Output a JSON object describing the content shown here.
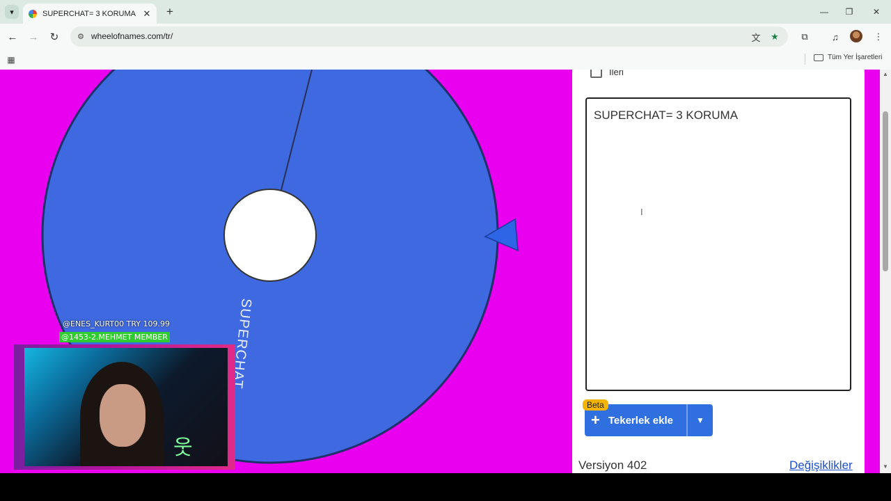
{
  "browser": {
    "tab_title": "SUPERCHAT= 3 KORUMA",
    "url": "wheelofnames.com/tr/",
    "bookmarks_label": "Tüm Yer İşaretleri"
  },
  "overlay": {
    "chat_line_1": "@ENES_KURT00  TRY 109.99",
    "chat_line_2": "@1453-2.MEHMET  MEMBER"
  },
  "wheel": {
    "segment_label": "SUPERCHAT",
    "color": "#3f69e0"
  },
  "sidebar": {
    "checkbox_label": "İleri",
    "entries_text": "SUPERCHAT= 3 KORUMA",
    "beta_badge": "Beta",
    "add_wheel_label": "Tekerlek ekle",
    "version": "Versiyon 402",
    "changes_link": "Değişiklikler"
  },
  "icons": {
    "tab_menu": "▾",
    "close": "✕",
    "new_tab": "+",
    "minimize": "—",
    "restore": "❐",
    "back": "←",
    "forward": "→",
    "reload": "↻",
    "site_info": "⚙",
    "translate": "文",
    "star": "★",
    "extensions": "⧉",
    "media": "♫",
    "menu": "⋮",
    "apps": "▦",
    "plus": "+",
    "dropdown": "▼",
    "ibeam": "I",
    "scroll_up": "▲",
    "scroll_down": "▼",
    "cam_logo": "웃"
  }
}
